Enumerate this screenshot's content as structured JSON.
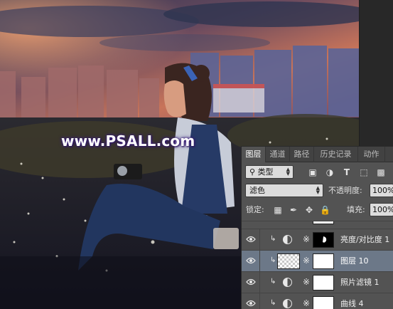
{
  "watermark": "www.PSALL.com",
  "panel": {
    "tabs": [
      {
        "label": "图层",
        "active": true
      },
      {
        "label": "通道",
        "active": false
      },
      {
        "label": "路径",
        "active": false
      },
      {
        "label": "历史记录",
        "active": false
      },
      {
        "label": "动作",
        "active": false
      }
    ],
    "filter": {
      "kind_label": "类型",
      "icons": [
        "image-filter-icon",
        "adjustment-filter-icon",
        "type-filter-icon",
        "shape-filter-icon",
        "smart-object-filter-icon"
      ]
    },
    "blend_mode": "滤色",
    "opacity_label": "不透明度:",
    "opacity_value": "100%",
    "lock_label": "锁定:",
    "lock_icons": [
      "lock-transparent-icon",
      "lock-paint-icon",
      "lock-move-icon",
      "lock-all-icon"
    ],
    "fill_label": "填充:",
    "fill_value": "100%",
    "layers": [
      {
        "name": "亮度/对比度 1",
        "type": "adjustment",
        "mask": "black-with-white-shape",
        "clipped": true,
        "visible": true,
        "selected": false
      },
      {
        "name": "图层 10",
        "type": "pixel",
        "mask": "white",
        "clipped": true,
        "visible": true,
        "selected": true
      },
      {
        "name": "照片滤镜 1",
        "type": "adjustment",
        "mask": "white",
        "clipped": true,
        "visible": true,
        "selected": false
      },
      {
        "name": "曲线 4",
        "type": "adjustment",
        "mask": "white",
        "clipped": true,
        "visible": true,
        "selected": false
      }
    ]
  },
  "colors": {
    "panel_bg": "#535353",
    "selected_row": "#6c7888",
    "tab_bar": "#424242"
  }
}
